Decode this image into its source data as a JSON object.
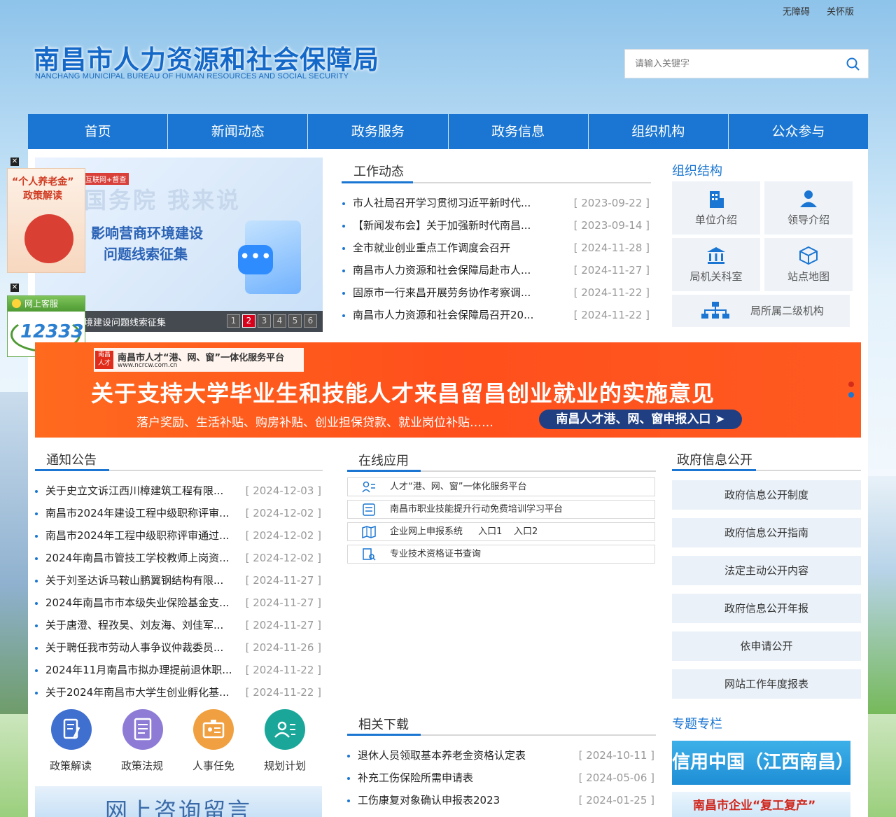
{
  "toplinks": [
    "无障碍",
    "关怀版"
  ],
  "logo": {
    "cn": "南昌市人力资源和社会保障局",
    "en": "NANCHANG MUNICIPAL BUREAU OF HUMAN RESOURCES AND SOCIAL SECURITY"
  },
  "search": {
    "placeholder": "请输入关键字"
  },
  "nav": [
    "首页",
    "新闻动态",
    "政务服务",
    "政务信息",
    "组织机构",
    "公众参与"
  ],
  "slider": {
    "tag": "互联网+督查",
    "bg_text": "国务院 我来说",
    "line1": "影响营商环境建设",
    "line2": "问题线索征集",
    "caption": "影响营商环境建设问题线索征集",
    "pages": [
      "1",
      "2",
      "3",
      "4",
      "5",
      "6"
    ],
    "active_page": "2"
  },
  "floaters": {
    "pension": {
      "line1": "“个人养老金”",
      "line2": "政策解读"
    },
    "service": {
      "head": "网上客服",
      "num": "12333"
    }
  },
  "work_news": {
    "title": "工作动态",
    "items": [
      {
        "text": "市人社局召开学习贯彻习近平新时代...",
        "date": "[ 2023-09-22 ]"
      },
      {
        "text": "【新闻发布会】关于加强新时代南昌...",
        "date": "[ 2023-09-14 ]"
      },
      {
        "text": "全市就业创业重点工作调度会召开",
        "date": "[ 2024-11-28 ]"
      },
      {
        "text": "南昌市人力资源和社会保障局赴市人...",
        "date": "[ 2024-11-27 ]"
      },
      {
        "text": "固原市一行来昌开展劳务协作考察调...",
        "date": "[ 2024-11-22 ]"
      },
      {
        "text": "南昌市人力资源和社会保障局召开20...",
        "date": "[ 2024-11-22 ]"
      }
    ]
  },
  "org": {
    "title": "组织结构",
    "tiles": [
      "单位介绍",
      "领导介绍",
      "局机关科室",
      "站点地图"
    ],
    "wide": "局所属二级机构"
  },
  "banner": {
    "header": "南昌市人才“港、网、窗”一体化服务平台",
    "url": "www.ncrcw.com.cn",
    "logo_text": "南昌人才",
    "main": "关于支持大学毕业生和技能人才来昌留昌创业就业的实施意见",
    "sub": "落户奖励、生活补贴、购房补贴、创业担保贷款、就业岗位补贴……",
    "button": "南昌人才港、网、窗申报入口 ➤"
  },
  "notices": {
    "title": "通知公告",
    "items": [
      {
        "text": "关于史立文诉江西川樟建筑工程有限...",
        "date": "[ 2024-12-03 ]"
      },
      {
        "text": "南昌市2024年建设工程中级职称评审...",
        "date": "[ 2024-12-02 ]"
      },
      {
        "text": "南昌市2024年工程中级职称评审通过...",
        "date": "[ 2024-12-02 ]"
      },
      {
        "text": "2024年南昌市管技工学校教师上岗资...",
        "date": "[ 2024-12-02 ]"
      },
      {
        "text": "关于刘圣达诉马鞍山鹏翼钢结构有限...",
        "date": "[ 2024-11-27 ]"
      },
      {
        "text": "2024年南昌市市本级失业保险基金支...",
        "date": "[ 2024-11-27 ]"
      },
      {
        "text": "关于唐澄、程孜昊、刘友海、刘佳军...",
        "date": "[ 2024-11-27 ]"
      },
      {
        "text": "关于聘任我市劳动人事争议仲裁委员...",
        "date": "[ 2024-11-26 ]"
      },
      {
        "text": "2024年11月南昌市拟办理提前退休职...",
        "date": "[ 2024-11-22 ]"
      },
      {
        "text": "关于2024年南昌市大学生创业孵化基...",
        "date": "[ 2024-11-22 ]"
      }
    ]
  },
  "online": {
    "title": "在线应用",
    "items": [
      {
        "text": "人才“港、网、窗”一体化服务平台",
        "extra": ""
      },
      {
        "text": "南昌市职业技能提升行动免费培训学习平台",
        "extra": ""
      },
      {
        "text": "企业网上申报系统",
        "extra": "入口1    入口2"
      },
      {
        "text": "专业技术资格证书查询",
        "extra": ""
      }
    ]
  },
  "gov_info": {
    "title": "政府信息公开",
    "items": [
      "政府信息公开制度",
      "政府信息公开指南",
      "法定主动公开内容",
      "政府信息公开年报",
      "依申请公开",
      "网站工作年度报表"
    ]
  },
  "quick_icons": [
    {
      "label": "政策解读",
      "color": "#3f6fcf"
    },
    {
      "label": "政策法规",
      "color": "#8e7bd6"
    },
    {
      "label": "人事任免",
      "color": "#f0a040"
    },
    {
      "label": "规划计划",
      "color": "#1aa79a"
    }
  ],
  "downloads": {
    "title": "相关下载",
    "items": [
      {
        "text": "退休人员领取基本养老金资格认定表",
        "date": "[ 2024-10-11 ]"
      },
      {
        "text": "补充工伤保险所需申请表",
        "date": "[ 2024-05-06 ]"
      },
      {
        "text": "工伤康复对象确认申报表2023",
        "date": "[ 2024-01-25 ]"
      }
    ]
  },
  "special": {
    "title": "专题专栏",
    "zt1": "信用中国（江西南昌）",
    "zt2": "南昌市企业“复工复产”"
  },
  "consult": {
    "text": "网上咨询留言"
  }
}
